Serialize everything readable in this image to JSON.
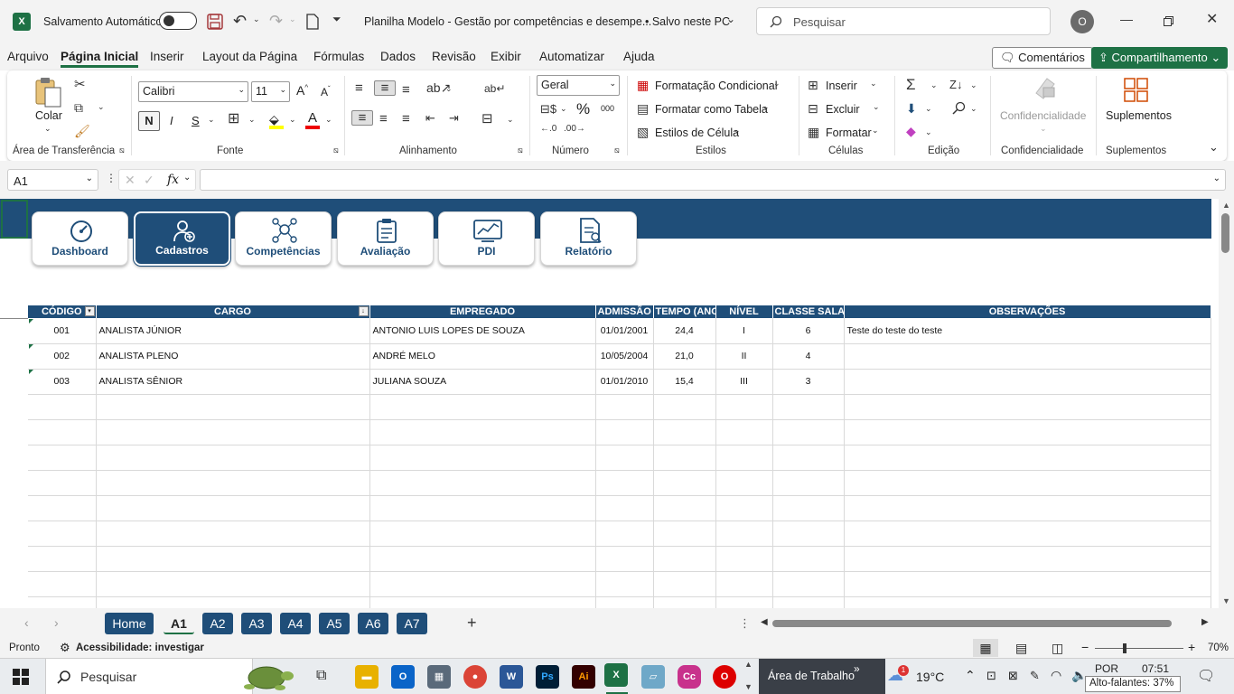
{
  "titlebar": {
    "autosave_label": "Salvamento Automático",
    "doc_title": "Planilha Modelo - Gestão por competências e desempe...",
    "save_status": "• Salvo neste PC",
    "search_placeholder": "Pesquisar",
    "avatar_initial": "O"
  },
  "menu": {
    "items": [
      "Arquivo",
      "Página Inicial",
      "Inserir",
      "Layout da Página",
      "Fórmulas",
      "Dados",
      "Revisão",
      "Exibir",
      "Automatizar",
      "Ajuda"
    ],
    "comments_label": "Comentários",
    "share_label": "Compartilhamento"
  },
  "ribbon": {
    "clipboard": {
      "paste_label": "Colar",
      "group_label": "Área de Transferência"
    },
    "font": {
      "font_name": "Calibri",
      "font_size": "11",
      "bold_label": "N",
      "italic_label": "I",
      "underline_label": "S",
      "group_label": "Fonte"
    },
    "alignment": {
      "group_label": "Alinhamento"
    },
    "number": {
      "format": "Geral",
      "percent": "%",
      "group_label": "Número"
    },
    "styles": {
      "conditional": "Formatação Condicional",
      "as_table": "Formatar como Tabela",
      "cell_styles": "Estilos de Célula",
      "group_label": "Estilos"
    },
    "cells": {
      "insert": "Inserir",
      "delete": "Excluir",
      "format": "Formatar",
      "group_label": "Células"
    },
    "editing": {
      "group_label": "Edição"
    },
    "sensitivity": {
      "button_label": "Confidencialidade",
      "group_label": "Confidencialidade"
    },
    "addins": {
      "button_label": "Suplementos",
      "group_label": "Suplementos"
    }
  },
  "formula_bar": {
    "name_box": "A1",
    "formula": ""
  },
  "nav_cards": [
    {
      "label": "Dashboard",
      "icon": "gauge-icon"
    },
    {
      "label": "Cadastros",
      "icon": "add-user-icon"
    },
    {
      "label": "Competências",
      "icon": "network-icon"
    },
    {
      "label": "Avaliação",
      "icon": "clipboard-icon"
    },
    {
      "label": "PDI",
      "icon": "chart-icon"
    },
    {
      "label": "Relatório",
      "icon": "report-icon"
    }
  ],
  "table": {
    "headers": [
      "CÓDIGO",
      "CARGO",
      "EMPREGADO",
      "ADMISSÃO",
      "TEMPO (ANO",
      "NÍVEL",
      "CLASSE SALARI",
      "OBSERVAÇÕES"
    ],
    "rows": [
      [
        "001",
        "ANALISTA JÚNIOR",
        "ANTONIO LUIS LOPES DE SOUZA",
        "01/01/2001",
        "24,4",
        "I",
        "6",
        "Teste do teste do teste"
      ],
      [
        "002",
        "ANALISTA PLENO",
        "ANDRÉ MELO",
        "10/05/2004",
        "21,0",
        "II",
        "4",
        ""
      ],
      [
        "003",
        "ANALISTA SÊNIOR",
        "JULIANA SOUZA",
        "01/01/2010",
        "15,4",
        "III",
        "3",
        ""
      ]
    ]
  },
  "sheet_tabs": [
    "Home",
    "A1",
    "A2",
    "A3",
    "A4",
    "A5",
    "A6",
    "A7"
  ],
  "status": {
    "ready": "Pronto",
    "accessibility": "Acessibilidade: investigar",
    "zoom": "70%"
  },
  "taskbar": {
    "search_placeholder": "Pesquisar",
    "desktop_label": "Área de Trabalho",
    "weather": "19°C",
    "language": "POR",
    "time": "07:51",
    "tooltip": "Alto-falantes: 37%",
    "notification_badge": "1"
  },
  "colors": {
    "banner": "#1f4e79",
    "excel_green": "#1e7145"
  }
}
